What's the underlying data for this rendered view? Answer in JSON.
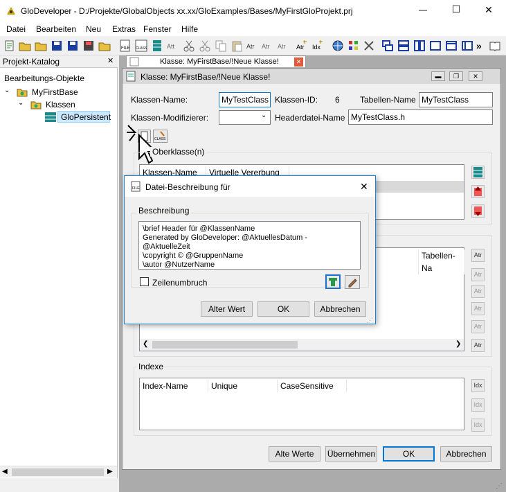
{
  "app": {
    "title": "GloDeveloper - D:/Projekte/GlobalObjects xx.xx/GloExamples/Bases/MyFirstGloProjekt.prj",
    "minimize": "—",
    "maximize": "☐",
    "close": "✕"
  },
  "menu": [
    "Datei",
    "Bearbeiten",
    "Neu",
    "Extras",
    "Fenster",
    "Hilfe"
  ],
  "catalog": {
    "title": "Projekt-Katalog",
    "close": "✕",
    "tree": {
      "root": "Bearbeitungs-Objekte",
      "base": "MyFirstBase",
      "folder": "Klassen",
      "item": "GloPersistent"
    }
  },
  "tab": {
    "label": "Klasse: MyFirstBase/!Neue Klasse!"
  },
  "class_window": {
    "title": "Klasse: MyFirstBase/!Neue Klasse!",
    "class_name_label": "Klassen-Name:",
    "class_name": "MyTestClass",
    "class_id_label": "Klassen-ID:",
    "class_id": "6",
    "table_name_label": "Tabellen-Name :",
    "table_name": "MyTestClass",
    "modifier_label": "Klassen-Modifizierer:",
    "modifier_value": "",
    "header_file_label": "Headerdatei-Name :",
    "header_file": "MyTestClass.h",
    "superclass_group": "Oberklasse(n)",
    "superclass_cols": [
      "Klassen-Name",
      "Virtuelle Vererbung"
    ],
    "attr_col_table": "Tabellen-Na",
    "index_group": "Indexe",
    "index_cols": [
      "Index-Name",
      "Unique",
      "CaseSensitive"
    ],
    "buttons": {
      "defaults": "Alte Werte",
      "apply": "Übernehmen",
      "ok": "OK",
      "cancel": "Abbrechen"
    }
  },
  "dialog": {
    "title": "Datei-Beschreibung für",
    "group": "Beschreibung",
    "text": [
      "\\brief Header für @KlassenName",
      "Generated by GloDeveloper: @AktuellesDatum - @AktuelleZeit",
      "\\copyright © @GruppenName",
      "\\autor @NutzerName"
    ],
    "wrap_label": "Zeilenumbruch",
    "buttons": {
      "old": "Alter Wert",
      "ok": "OK",
      "cancel": "Abbrechen"
    },
    "close": "✕"
  }
}
